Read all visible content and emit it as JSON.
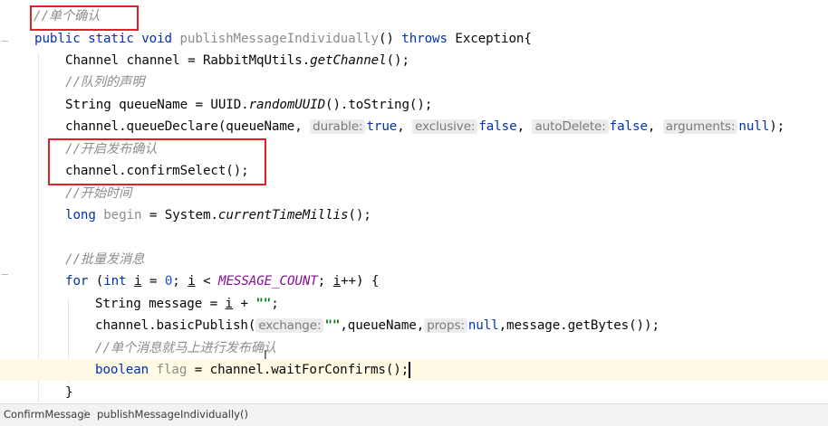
{
  "code": {
    "comment_single": "//单个确认",
    "kw_public": "public",
    "kw_static": "static",
    "kw_void": "void",
    "method_name": "publishMessageIndividually",
    "sig_parens": "()",
    "kw_throws": "throws",
    "exception": "Exception{",
    "l3_type": "Channel channel = RabbitMqUtils.",
    "l3_method": "getChannel",
    "l3_end": "();",
    "comment_queue": "//队列的声明",
    "l5_start": "String queueName = UUID.",
    "l5_method": "randomUUID",
    "l5_end": "().toString();",
    "l6_start": "channel.queueDeclare(queueName,",
    "hint_durable": "durable:",
    "val_true": "true",
    "hint_exclusive": "exclusive:",
    "val_false_1": "false",
    "hint_autodelete": "autoDelete:",
    "val_false_2": "false",
    "hint_arguments": "arguments:",
    "val_null_1": "null",
    "l6_end": ");",
    "comma": ",",
    "comment_confirm": "//开启发布确认",
    "l8_code": "channel.confirmSelect();",
    "comment_start_time": "//开始时间",
    "kw_long": "long",
    "var_begin": "begin",
    "l10_mid": "= System.",
    "l10_method": "currentTimeMillis",
    "l10_end": "();",
    "comment_batch": "//批量发消息",
    "kw_for": "for",
    "for_open": "(",
    "kw_int": "int",
    "var_i": "i",
    "for_eq": "=",
    "num_zero": "0",
    "semi": ";",
    "lt": "<",
    "const_count": "MESSAGE_COUNT",
    "inc": "++) {",
    "l14_start": "String message =",
    "plus": "+",
    "str_empty": "\"\"",
    "l15_start": "channel.basicPublish(",
    "hint_exchange": "exchange:",
    "l15_mid": ",queueName,",
    "hint_props": "props:",
    "val_null_2": "null",
    "l15_end": ",message.getBytes());",
    "comment_single_msg": "//单个消息就马上进行发布确认",
    "kw_boolean": "boolean",
    "var_flag": "flag",
    "l17_end": "= channel.waitForConfirms();",
    "close_brace": "}"
  },
  "cursor_glyph": "I",
  "status_bar": {
    "crumb_class": "ConfirmMessage",
    "separator": "〉",
    "crumb_method": "publishMessageIndividually()"
  },
  "colors": {
    "keyword": "#0033b3",
    "comment": "#8c8c8c",
    "string": "#067d17",
    "constant": "#871094",
    "number": "#1750eb",
    "highlight_box": "#e0202b",
    "current_line": "#fffae3"
  }
}
